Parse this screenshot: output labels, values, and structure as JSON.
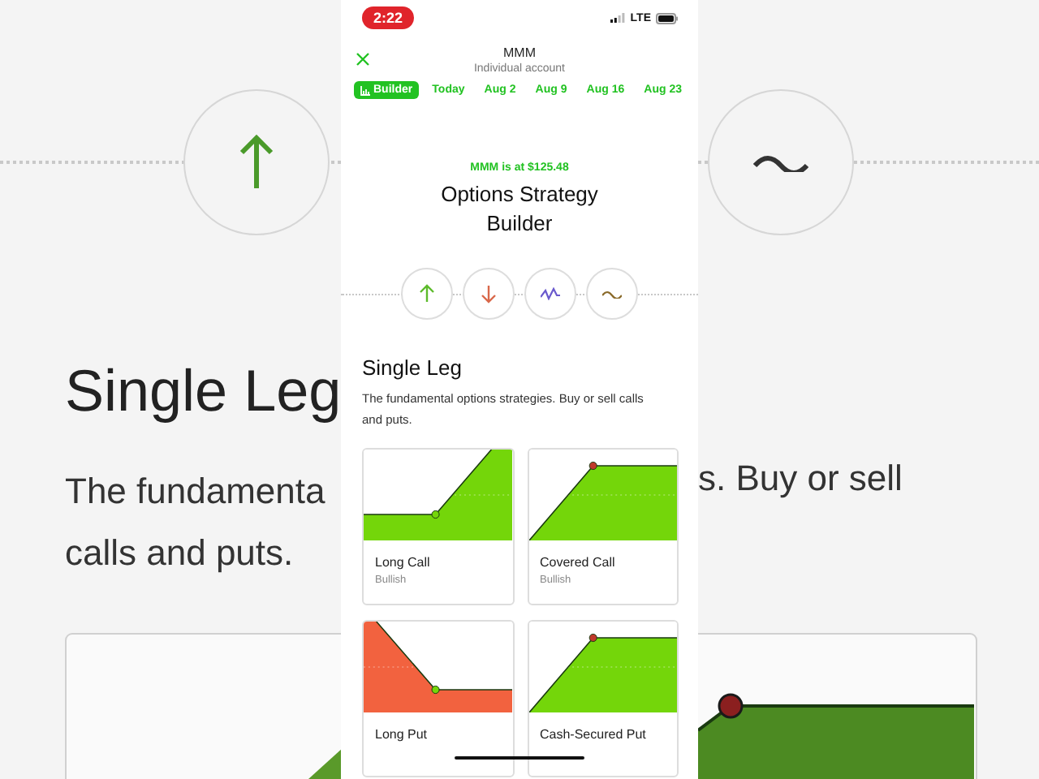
{
  "background": {
    "heading": "Single Leg",
    "text_left_1": "The fundamenta",
    "text_left_2": "calls and puts.",
    "text_right": "s. Buy or sell"
  },
  "status_bar": {
    "time": "2:22",
    "network": "LTE"
  },
  "header": {
    "symbol": "MMM",
    "account": "Individual account"
  },
  "tabs": [
    {
      "label": "Builder",
      "selected": true
    },
    {
      "label": "Today",
      "selected": false
    },
    {
      "label": "Aug 2",
      "selected": false
    },
    {
      "label": "Aug 9",
      "selected": false
    },
    {
      "label": "Aug 16",
      "selected": false
    },
    {
      "label": "Aug 23",
      "selected": false
    }
  ],
  "price_note": "MMM is at $125.48",
  "title": "Options Strategy Builder",
  "outlook_buttons": [
    {
      "kind": "bullish"
    },
    {
      "kind": "bearish"
    },
    {
      "kind": "volatile"
    },
    {
      "kind": "neutral"
    }
  ],
  "section": {
    "title": "Single Leg",
    "description": "The fundamental options strategies. Buy or sell calls and puts."
  },
  "strategies": [
    {
      "name": "Long Call",
      "sentiment": "Bullish",
      "kind": "long-call"
    },
    {
      "name": "Covered Call",
      "sentiment": "Bullish",
      "kind": "covered-call"
    },
    {
      "name": "Long Put",
      "kind": "long-put"
    },
    {
      "name": "Cash-Secured Put",
      "kind": "cash-secured-put"
    }
  ]
}
